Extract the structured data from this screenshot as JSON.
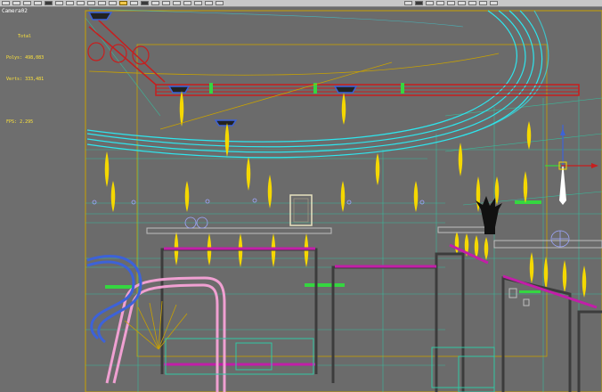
{
  "viewport": {
    "label": "Camera02"
  },
  "stats": {
    "header": "Total",
    "polys_label": "Polys:",
    "polys_value": "498,083",
    "verts_label": "Verts:",
    "verts_value": "333,481",
    "fps_label": "FPS:",
    "fps_value": "2.295"
  },
  "toolbar": {
    "buttons": [
      "select-object",
      "select-by-name",
      "select-region",
      "window-crossing",
      "select-move",
      "select-rotate",
      "select-scale",
      "reference-coord",
      "use-pivot",
      "select-manipulate",
      "keyboard-shortcut",
      "snaps-toggle",
      "angle-snap",
      "percent-snap",
      "spinner-snap",
      "edit-named-selections",
      "mirror",
      "align",
      "layer-manager",
      "curve-editor",
      "schematic-view",
      "material-editor",
      "render-setup",
      "render-frame",
      "quick-render",
      "render-production",
      "activeshade",
      "environment",
      "effects",
      "render-to-texture"
    ],
    "active_index": 11
  },
  "colors": {
    "background": "#6b6b6b",
    "cyan": "#2ee6ee",
    "red": "#c81e1e",
    "yellow": "#f5d800",
    "magenta": "#c21ea8",
    "green": "#35d640",
    "teal": "#31c7a3",
    "blue": "#3d62d8",
    "pink": "#f0a0d2",
    "gold": "#c9a200"
  }
}
